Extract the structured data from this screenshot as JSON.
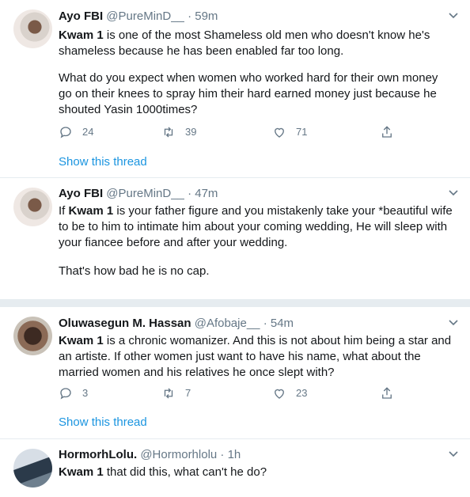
{
  "tweets": [
    {
      "name": "Ayo FBI",
      "handle": "@PureMinD__",
      "time": "· 59m",
      "bold": "Kwam 1",
      "text1": " is one of the most Shameless old men who doesn't know he's shameless because he has been enabled far too long.",
      "text2": "What do you expect when women who worked hard for their own money go on their knees to spray him their hard earned money just because he shouted Yasin 1000times?",
      "replies": "24",
      "retweets": "39",
      "likes": "71",
      "thread_link": "Show this thread"
    },
    {
      "name": "Ayo FBI",
      "handle": "@PureMinD__",
      "time": "· 47m",
      "pre": "If ",
      "bold": "Kwam 1",
      "text1": " is your father figure and you mistakenly take your *beautiful wife to be to him to intimate him about your coming wedding, He will sleep with your fiancee before and after your wedding.",
      "text2": "That's how bad he is no cap."
    },
    {
      "name": "Oluwasegun M. Hassan",
      "handle": "@Afobaje__",
      "time": "· 54m",
      "bold": "Kwam 1",
      "text1": " is a chronic womanizer. And this is not about him being a star and an artiste. If other women just want to have his name, what about the married women and his relatives he once slept with?",
      "replies": "3",
      "retweets": "7",
      "likes": "23",
      "thread_link": "Show this thread"
    },
    {
      "name": "HormorhLolu.",
      "handle": "@Hormorhlolu",
      "time": "· 1h",
      "bold": "Kwam 1",
      "text1": " that did this, what can't he do?"
    }
  ],
  "colors": {
    "link": "#1b95e0",
    "muted": "#657786",
    "divider": "#e6ecf0"
  }
}
